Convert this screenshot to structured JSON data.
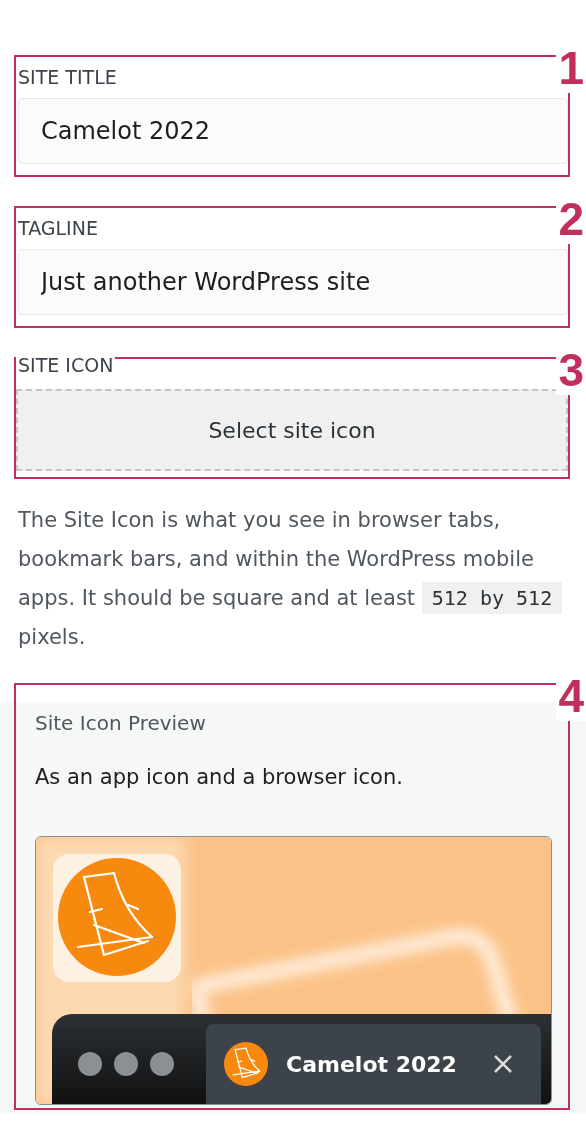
{
  "sections": [
    {
      "kind": "text-field",
      "number": "1",
      "label": "SITE TITLE",
      "value": "Camelot 2022"
    },
    {
      "kind": "text-field",
      "number": "2",
      "label": "TAGLINE",
      "value": "Just another WordPress site"
    },
    {
      "kind": "icon-button",
      "number": "3",
      "label": "SITE ICON",
      "button": "Select site icon"
    }
  ],
  "help": {
    "text": "The Site Icon is what you see in browser tabs, bookmark bars, and within the WordPress mobile apps. It should be square and at least",
    "code": "512 by 512",
    "after": "pixels."
  },
  "preview": {
    "number": "4",
    "title": "Site Icon Preview",
    "description": "As an app icon and a browser icon.",
    "tab_title": "Camelot 2022"
  }
}
